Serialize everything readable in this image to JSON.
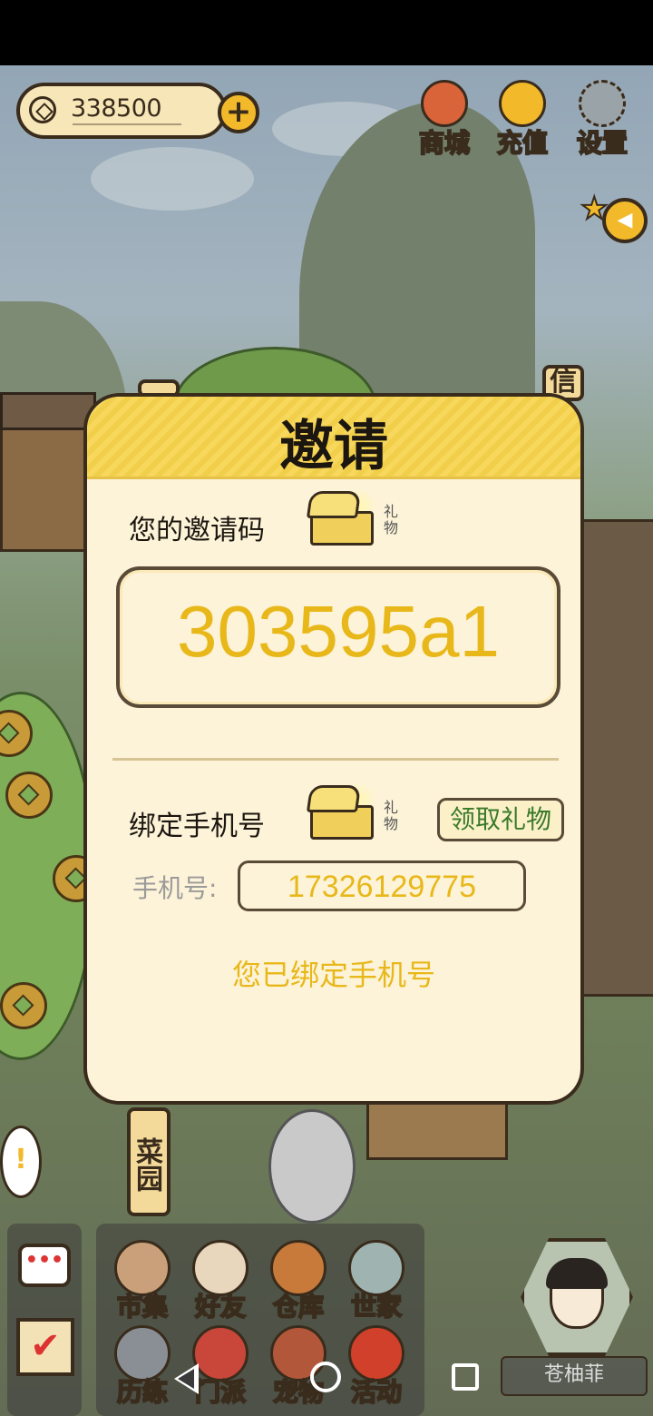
{
  "currency": {
    "amount": "338500",
    "plus": "+"
  },
  "top_buttons": [
    {
      "label": "商城",
      "icon": "money-bag-icon",
      "color": "#d9643a"
    },
    {
      "label": "充值",
      "icon": "gold-ingot-icon",
      "color": "#f2b92a"
    },
    {
      "label": "设置",
      "icon": "gear-icon",
      "color": "#9aa3a8"
    }
  ],
  "signs": {
    "left_top": "",
    "right_top": "信",
    "vegetable_garden": "菜园"
  },
  "dialog": {
    "title": "邀请",
    "invite_label": "您的邀请码",
    "gift_text": "礼物",
    "invite_code": "303595a1",
    "bind_label": "绑定手机号",
    "claim_button": "领取礼物",
    "phone_label": "手机号:",
    "phone_number": "17326129775",
    "bound_status": "您已绑定手机号"
  },
  "chat": {
    "bubble": "•••",
    "check": "✔"
  },
  "menu": [
    {
      "label": "市集",
      "icon": "market-icon"
    },
    {
      "label": "好友",
      "icon": "handshake-icon"
    },
    {
      "label": "仓库",
      "icon": "chest-icon"
    },
    {
      "label": "世家",
      "icon": "teapot-icon"
    },
    {
      "label": "历练",
      "icon": "swords-icon"
    },
    {
      "label": "门派",
      "icon": "sect-icon"
    },
    {
      "label": "宠物",
      "icon": "pet-icon"
    },
    {
      "label": "活动",
      "icon": "lantern-icon"
    }
  ],
  "player": {
    "name": "苍柚菲"
  },
  "colors": {
    "accent": "#e8b81a",
    "claim_text": "#3a7a2a",
    "header": "#f7d75c"
  }
}
